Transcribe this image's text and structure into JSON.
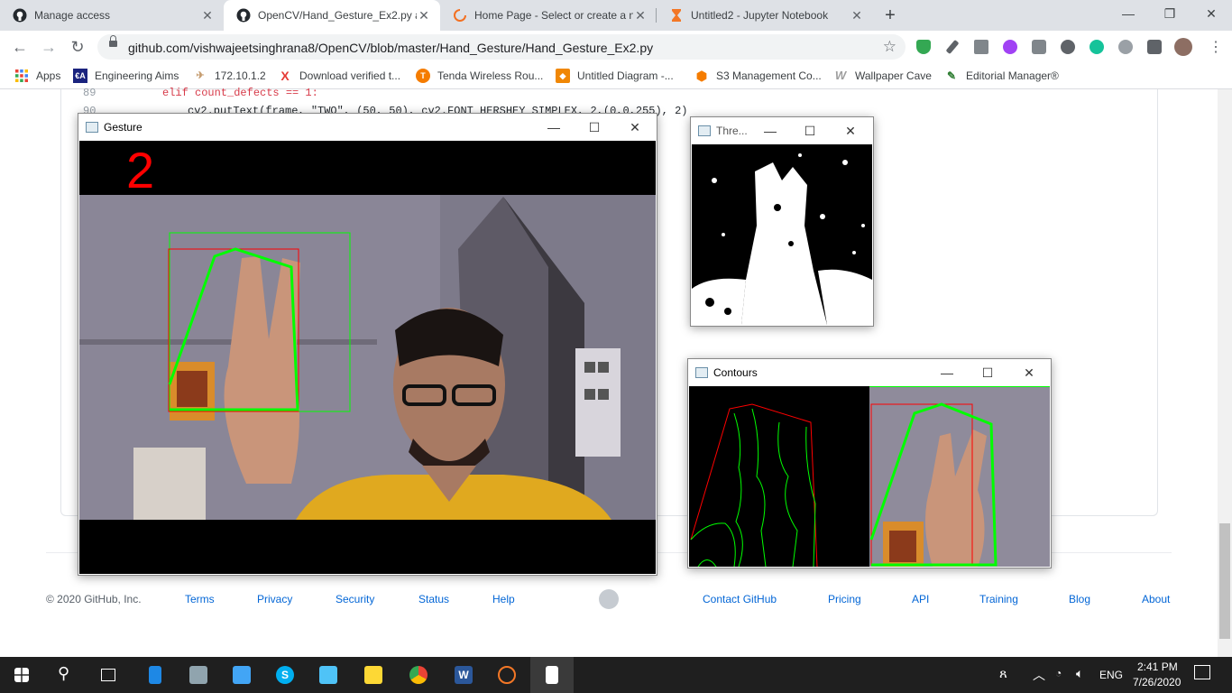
{
  "browser": {
    "tabs": [
      {
        "title": "Manage access",
        "icon": "github-icon",
        "active": false
      },
      {
        "title": "OpenCV/Hand_Gesture_Ex2.py at",
        "icon": "github-icon",
        "active": true
      },
      {
        "title": "Home Page - Select or create a n",
        "icon": "loading-spinner-icon",
        "active": false
      },
      {
        "title": "Untitled2 - Jupyter Notebook",
        "icon": "hourglass-icon",
        "active": false
      }
    ],
    "new_tab": "+",
    "window_controls": {
      "minimize": "—",
      "restore": "❐",
      "close": "✕"
    },
    "url": "github.com/vishwajeetsinghrana8/OpenCV/blob/master/Hand_Gesture/Hand_Gesture_Ex2.py",
    "nav": {
      "back": "←",
      "forward": "→",
      "reload": "↻",
      "star": "☆"
    },
    "bookmarks": [
      {
        "label": "Apps",
        "icon": "apps-grid-icon"
      },
      {
        "label": "Engineering Aims",
        "icon": "ea-logo-icon"
      },
      {
        "label": "172.10.1.2",
        "icon": "plane-icon"
      },
      {
        "label": "Download verified t...",
        "icon": "x-logo-icon"
      },
      {
        "label": "Tenda Wireless Rou...",
        "icon": "tenda-icon"
      },
      {
        "label": "Untitled Diagram -...",
        "icon": "diagram-icon"
      },
      {
        "label": "S3 Management Co...",
        "icon": "aws-cube-icon"
      },
      {
        "label": "Wallpaper Cave",
        "icon": "wallpaper-cave-icon"
      },
      {
        "label": "Editorial Manager®",
        "icon": "editorial-icon"
      }
    ]
  },
  "code": {
    "line_89_number": "89",
    "line_89": "elif count_defects == 1:",
    "line_90_number": "90",
    "line_90": "cv2.putText(frame, \"TWO\", (50, 50), cv2.FONT_HERSHEY_SIMPLEX, 2,(0,0,255), 2)"
  },
  "footer": {
    "copyright": "© 2020 GitHub, Inc.",
    "left_links": [
      "Terms",
      "Privacy",
      "Security",
      "Status",
      "Help"
    ],
    "right_links": [
      "Contact GitHub",
      "Pricing",
      "API",
      "Training",
      "Blog",
      "About"
    ]
  },
  "windows": {
    "gesture": {
      "title": "Gesture",
      "overlay_text": "2"
    },
    "threshold": {
      "title": "Thre..."
    },
    "contours": {
      "title": "Contours"
    }
  },
  "taskbar": {
    "language": "ENG",
    "time": "2:41 PM",
    "date": "7/26/2020"
  },
  "colors": {
    "accent_link": "#0366d6",
    "overlay_red": "#ff0000",
    "hull_green": "#00ff00",
    "taskbar_bg": "#1f1f1f"
  }
}
